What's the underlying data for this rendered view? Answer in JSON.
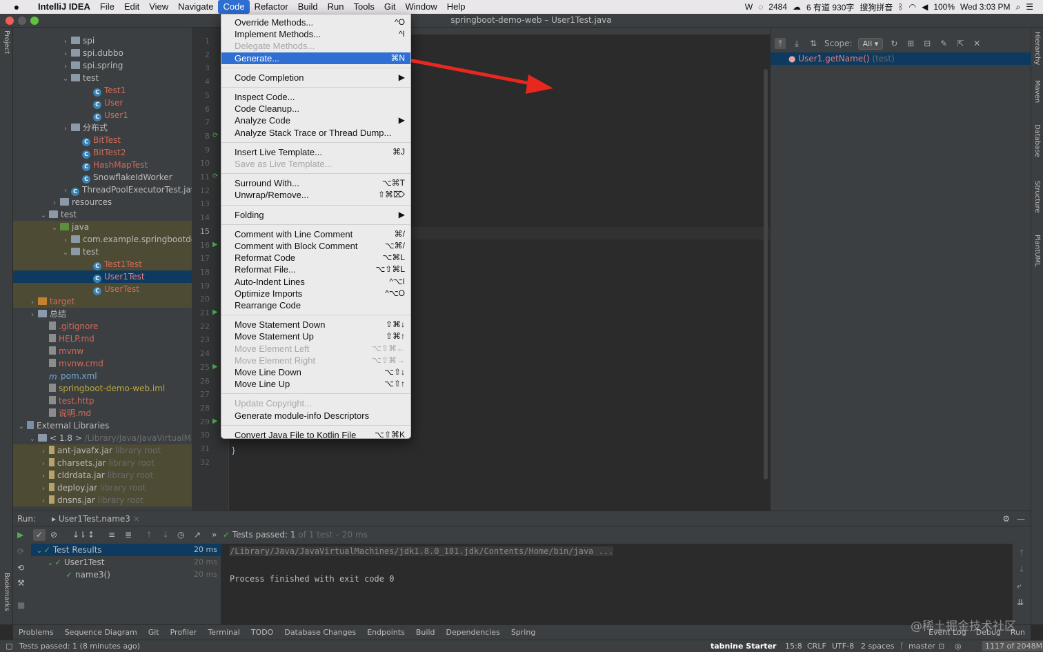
{
  "menubar": {
    "app_name": "IntelliJ IDEA",
    "items": [
      "File",
      "Edit",
      "View",
      "Navigate",
      "Code",
      "Refactor",
      "Build",
      "Run",
      "Tools",
      "Git",
      "Window",
      "Help"
    ],
    "active_item": "Code",
    "tray": {
      "count": "2484",
      "youdao": "6 有道 930字",
      "input_method": "搜狗拼音",
      "battery": "100%",
      "clock": "Wed 3:03 PM"
    }
  },
  "window": {
    "title": "springboot-demo-web – User1Test.java",
    "left_tool_label": "Project",
    "bookmarks_label": "Bookmarks",
    "right_tools": [
      "Hierarchy",
      "Maven",
      "Database",
      "Structure",
      "PlantUML"
    ]
  },
  "project_tree": [
    {
      "label": "spi",
      "icon": "folder",
      "chev": "›"
    },
    {
      "label": "spi.dubbo",
      "icon": "folder",
      "chev": "›"
    },
    {
      "label": "spi.spring",
      "icon": "folder",
      "chev": "›"
    },
    {
      "label": "test",
      "icon": "folder",
      "chev": "⌄"
    },
    {
      "label": "Test1",
      "icon": "class",
      "color": "red"
    },
    {
      "label": "User",
      "icon": "class",
      "color": "red"
    },
    {
      "label": "User1",
      "icon": "class",
      "color": "red"
    },
    {
      "label": "分布式",
      "icon": "folder",
      "chev": "›"
    },
    {
      "label": "BitTest",
      "icon": "class",
      "color": "red"
    },
    {
      "label": "BitTest2",
      "icon": "class",
      "color": "red"
    },
    {
      "label": "HashMapTest",
      "icon": "class",
      "color": "red"
    },
    {
      "label": "SnowflakeIdWorker",
      "icon": "class"
    },
    {
      "label": "ThreadPoolExecutorTest.java",
      "icon": "class",
      "chev": "›"
    },
    {
      "label": "resources",
      "icon": "folder",
      "chev": "›"
    },
    {
      "label": "test",
      "icon": "folder",
      "chev": "⌄"
    },
    {
      "label": "java",
      "icon": "folder-green",
      "chev": "⌄",
      "hl": true
    },
    {
      "label": "com.example.springbootdemo",
      "icon": "folder",
      "chev": "›",
      "hl": true
    },
    {
      "label": "test",
      "icon": "folder",
      "chev": "⌄",
      "hl": true
    },
    {
      "label": "Test1Test",
      "icon": "class",
      "color": "red",
      "hl": true
    },
    {
      "label": "User1Test",
      "icon": "class",
      "color": "red",
      "sel": true
    },
    {
      "label": "UserTest",
      "icon": "class",
      "color": "red",
      "hl": true
    },
    {
      "label": "target",
      "icon": "folder-orange",
      "chev": "›",
      "color": "red",
      "hl": true
    },
    {
      "label": "总结",
      "icon": "folder",
      "chev": "›"
    },
    {
      "label": ".gitignore",
      "icon": "file",
      "color": "red"
    },
    {
      "label": "HELP.md",
      "icon": "file",
      "color": "red"
    },
    {
      "label": "mvnw",
      "icon": "file",
      "color": "red"
    },
    {
      "label": "mvnw.cmd",
      "icon": "file",
      "color": "red"
    },
    {
      "label": "pom.xml",
      "icon": "maven",
      "color": "blue"
    },
    {
      "label": "springboot-demo-web.iml",
      "icon": "file",
      "color": "yellow"
    },
    {
      "label": "test.http",
      "icon": "file",
      "color": "red"
    },
    {
      "label": "说明.md",
      "icon": "file",
      "color": "red"
    },
    {
      "label": "External Libraries",
      "icon": "lib",
      "chev": "⌄"
    },
    {
      "label": "< 1.8 >",
      "suffix": "/Library/Java/JavaVirtualMachines",
      "icon": "folder",
      "chev": "⌄"
    },
    {
      "label": "ant-javafx.jar",
      "suffix": "library root",
      "icon": "jar",
      "chev": "›",
      "hl": true
    },
    {
      "label": "charsets.jar",
      "suffix": "library root",
      "icon": "jar",
      "chev": "›",
      "hl": true
    },
    {
      "label": "cldrdata.jar",
      "suffix": "library root",
      "icon": "jar",
      "chev": "›",
      "hl": true
    },
    {
      "label": "deploy.jar",
      "suffix": "library root",
      "icon": "jar",
      "chev": "›",
      "hl": true
    },
    {
      "label": "dnsns.jar",
      "suffix": "library root",
      "icon": "jar",
      "chev": "›",
      "hl": true
    }
  ],
  "editor": {
    "line_numbers": [
      "1",
      "2",
      "3",
      "4",
      "5",
      "6",
      "7",
      "8",
      "9",
      "10",
      "11",
      "12",
      "13",
      "14",
      "15",
      "16",
      "17",
      "18",
      "19",
      "20",
      "21",
      "22",
      "23",
      "24",
      "25",
      "26",
      "27",
      "28",
      "29",
      "30",
      "31",
      "32"
    ],
    "closing_brace": "}"
  },
  "code_menu": [
    {
      "type": "item",
      "label": "Override Methods...",
      "shortcut": "^O"
    },
    {
      "type": "item",
      "label": "Implement Methods...",
      "shortcut": "^I"
    },
    {
      "type": "item",
      "label": "Delegate Methods...",
      "disabled": true
    },
    {
      "type": "item",
      "label": "Generate...",
      "shortcut": "⌘N",
      "hover": true
    },
    {
      "type": "sep"
    },
    {
      "type": "item",
      "label": "Code Completion",
      "shortcut": "▶"
    },
    {
      "type": "sep"
    },
    {
      "type": "item",
      "label": "Inspect Code..."
    },
    {
      "type": "item",
      "label": "Code Cleanup..."
    },
    {
      "type": "item",
      "label": "Analyze Code",
      "shortcut": "▶"
    },
    {
      "type": "item",
      "label": "Analyze Stack Trace or Thread Dump..."
    },
    {
      "type": "sep"
    },
    {
      "type": "item",
      "label": "Insert Live Template...",
      "shortcut": "⌘J"
    },
    {
      "type": "item",
      "label": "Save as Live Template...",
      "disabled": true
    },
    {
      "type": "sep"
    },
    {
      "type": "item",
      "label": "Surround With...",
      "shortcut": "⌥⌘T"
    },
    {
      "type": "item",
      "label": "Unwrap/Remove...",
      "shortcut": "⇧⌘⌦"
    },
    {
      "type": "sep"
    },
    {
      "type": "item",
      "label": "Folding",
      "shortcut": "▶"
    },
    {
      "type": "sep"
    },
    {
      "type": "item",
      "label": "Comment with Line Comment",
      "shortcut": "⌘/"
    },
    {
      "type": "item",
      "label": "Comment with Block Comment",
      "shortcut": "⌥⌘/"
    },
    {
      "type": "item",
      "label": "Reformat Code",
      "shortcut": "⌥⌘L"
    },
    {
      "type": "item",
      "label": "Reformat File...",
      "shortcut": "⌥⇧⌘L"
    },
    {
      "type": "item",
      "label": "Auto-Indent Lines",
      "shortcut": "^⌥I"
    },
    {
      "type": "item",
      "label": "Optimize Imports",
      "shortcut": "^⌥O"
    },
    {
      "type": "item",
      "label": "Rearrange Code"
    },
    {
      "type": "sep"
    },
    {
      "type": "item",
      "label": "Move Statement Down",
      "shortcut": "⇧⌘↓"
    },
    {
      "type": "item",
      "label": "Move Statement Up",
      "shortcut": "⇧⌘↑"
    },
    {
      "type": "item",
      "label": "Move Element Left",
      "shortcut": "⌥⇧⌘←",
      "disabled": true
    },
    {
      "type": "item",
      "label": "Move Element Right",
      "shortcut": "⌥⇧⌘→",
      "disabled": true
    },
    {
      "type": "item",
      "label": "Move Line Down",
      "shortcut": "⌥⇧↓"
    },
    {
      "type": "item",
      "label": "Move Line Up",
      "shortcut": "⌥⇧↑"
    },
    {
      "type": "sep"
    },
    {
      "type": "item",
      "label": "Update Copyright...",
      "disabled": true
    },
    {
      "type": "item",
      "label": "Generate module-info Descriptors"
    },
    {
      "type": "sep"
    },
    {
      "type": "item",
      "label": "Convert Java File to Kotlin File",
      "shortcut": "⌥⇧⌘K"
    }
  ],
  "hierarchy": {
    "scope_label": "Scope:",
    "scope_value": "All",
    "row_label": "User1.getName()",
    "row_suffix": "(test)"
  },
  "run": {
    "label": "Run:",
    "config_tab": "User1Test.name3",
    "status_prefix": "Tests passed:",
    "status_count": "1",
    "status_rest": "of 1 test – 20 ms",
    "tree": [
      {
        "label": "Test Results",
        "time": "20 ms",
        "indent": 0
      },
      {
        "label": "User1Test",
        "time": "20 ms",
        "indent": 1
      },
      {
        "label": "name3()",
        "time": "20 ms",
        "indent": 2
      }
    ],
    "console_lines": [
      "/Library/Java/JavaVirtualMachines/jdk1.8.0_181.jdk/Contents/Home/bin/java ...",
      "",
      "Process finished with exit code 0"
    ]
  },
  "bottom_tabs": [
    "Problems",
    "Sequence Diagram",
    "Git",
    "Profiler",
    "Terminal",
    "TODO",
    "Database Changes",
    "Endpoints",
    "Build",
    "Dependencies",
    "Spring"
  ],
  "bottom_right_tabs": [
    "Event Log",
    "Debug",
    "Run"
  ],
  "status": {
    "left": "Tests passed: 1 (8 minutes ago)",
    "tabnine": "tabnine Starter",
    "position": "15:8",
    "line_sep": "CRLF",
    "encoding": "UTF-8",
    "indent": "2 spaces",
    "branch": "master",
    "memory": "1117 of 2048M"
  },
  "watermark": "@稀土掘金技术社区",
  "colors": {
    "accent": "#2f6fd4",
    "arrow": "#e8281e",
    "selection": "#0d3a5e"
  }
}
